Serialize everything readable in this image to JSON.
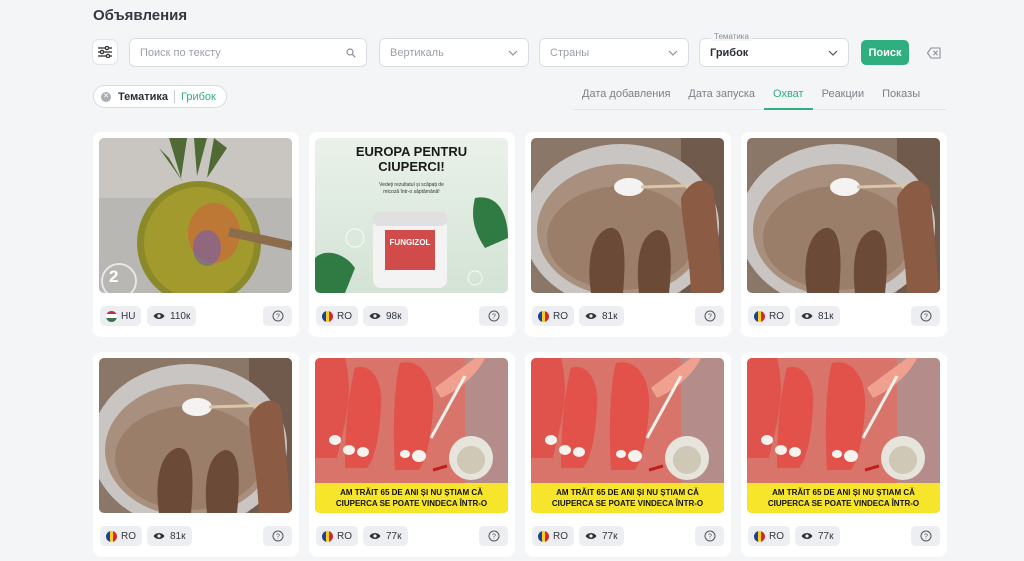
{
  "page": {
    "title": "Объявления"
  },
  "filters": {
    "search_placeholder": "Поиск по тексту",
    "vertical_placeholder": "Вертикаль",
    "countries_placeholder": "Страны",
    "topic_legend": "Тематика",
    "topic_value": "Грибок",
    "search_button": "Поиск"
  },
  "active_chip": {
    "key": "Тематика",
    "value": "Грибок"
  },
  "sort_tabs": [
    {
      "label": "Дата добавления",
      "active": false
    },
    {
      "label": "Дата запуска",
      "active": false
    },
    {
      "label": "Охват",
      "active": true
    },
    {
      "label": "Реакции",
      "active": false
    },
    {
      "label": "Показы",
      "active": false
    }
  ],
  "colors": {
    "accent": "#2fae7f"
  },
  "cards": [
    {
      "country": "HU",
      "views": "110к",
      "thumb_badge": "2",
      "image": "pineapple"
    },
    {
      "country": "RO",
      "views": "98к",
      "image": "fungizol",
      "headline": "EUROPA PENTRU CIUPERCI!",
      "subtext": "Vedeți rezultatul și scăpați de micoză într-o săptămână!",
      "product": "FUNGIZOL"
    },
    {
      "country": "RO",
      "views": "81к",
      "image": "foot-bath"
    },
    {
      "country": "RO",
      "views": "81к",
      "image": "foot-bath"
    },
    {
      "country": "RO",
      "views": "81к",
      "image": "foot-bath"
    },
    {
      "country": "RO",
      "views": "77к",
      "image": "feet",
      "caption1": "AM TRĂIT 65 DE ANI ȘI NU ȘTIAM CĂ",
      "caption2": "CIUPERCA SE POATE VINDECA ÎNTR-O"
    },
    {
      "country": "RO",
      "views": "77к",
      "image": "feet",
      "caption1": "AM TRĂIT 65 DE ANI ȘI NU ȘTIAM CĂ",
      "caption2": "CIUPERCA SE POATE VINDECA ÎNTR-O"
    },
    {
      "country": "RO",
      "views": "77к",
      "image": "feet",
      "caption1": "AM TRĂIT 65 DE ANI ȘI NU ȘTIAM CĂ",
      "caption2": "CIUPERCA SE POATE VINDECA ÎNTR-O"
    }
  ]
}
